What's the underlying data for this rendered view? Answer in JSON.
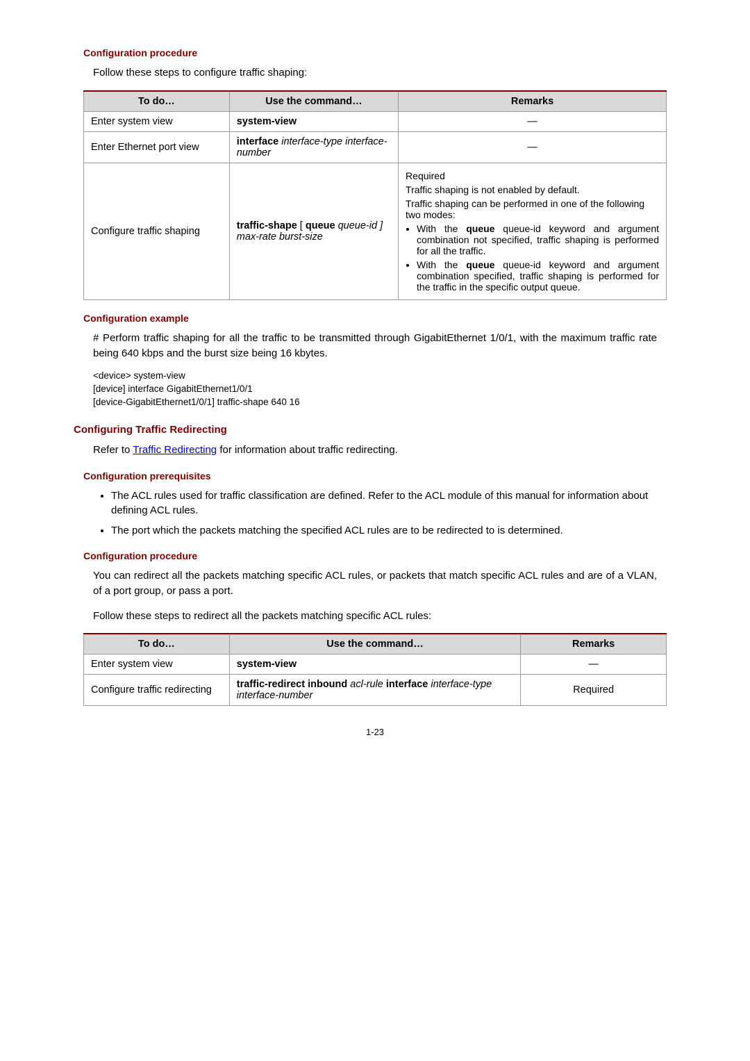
{
  "sec1": {
    "h_proc": "Configuration procedure",
    "intro": "Follow these steps to configure traffic shaping:",
    "table": {
      "head": {
        "c1": "To do…",
        "c2": "Use the command…",
        "c3": "Remarks"
      },
      "r1": {
        "c1": "Enter system view",
        "c2": "system-view",
        "c3": "—"
      },
      "r2": {
        "c1": "Enter Ethernet port view",
        "c2a": "interface",
        "c2b": " interface-type interface-number",
        "c3": "—"
      },
      "r3": {
        "c1": "Configure traffic shaping",
        "c2a": "traffic-shape",
        "c2b": " [ ",
        "c2c": "queue",
        "c2d": " queue-id ] max-rate burst-size",
        "rem_req": "Required",
        "rem_p1": "Traffic shaping is not enabled by default.",
        "rem_p2": "Traffic shaping can be performed in one of the following two modes:",
        "rem_li1a": "With the ",
        "rem_li1b": "queue",
        "rem_li1c": " queue-id keyword and argument combination not specified, traffic shaping is performed for all the traffic.",
        "rem_li2a": "With the ",
        "rem_li2b": "queue",
        "rem_li2c": " queue-id keyword and argument combination specified, traffic shaping is performed for the traffic in the specific output queue."
      }
    }
  },
  "sec2": {
    "h_ex": "Configuration example",
    "p1": "# Perform traffic shaping for all the traffic to be transmitted through GigabitEthernet 1/0/1, with the maximum traffic rate being 640 kbps and the burst size being 16 kbytes.",
    "code1": "<device> system-view",
    "code2": "[device] interface GigabitEthernet1/0/1",
    "code3": "[device-GigabitEthernet1/0/1] traffic-shape 640 16"
  },
  "sec3": {
    "h_main": "Configuring Traffic Redirecting",
    "ref_a": "Refer to ",
    "ref_link": "Traffic Redirecting",
    "ref_b": " for information about traffic redirecting.",
    "h_prereq": "Configuration prerequisites",
    "li1": "The ACL rules used for traffic classification are defined. Refer to the ACL module of this manual for information about defining ACL rules.",
    "li2": "The port which the packets matching the specified ACL rules are to be redirected to is determined.",
    "h_proc": "Configuration procedure",
    "p1": "You can redirect all the packets matching specific ACL rules, or packets that match specific ACL rules and are of a VLAN, of a port group, or pass a port.",
    "p2": "Follow these steps to redirect all the packets matching specific ACL rules:",
    "table": {
      "head": {
        "c1": "To do…",
        "c2": "Use the command…",
        "c3": "Remarks"
      },
      "r1": {
        "c1": "Enter system view",
        "c2": "system-view",
        "c3": "—"
      },
      "r2": {
        "c1": "Configure traffic redirecting",
        "c2a": "traffic-redirect inbound",
        "c2b": " acl-rule ",
        "c2c": "interface",
        "c2d": " interface-type interface-number",
        "c3": "Required"
      }
    }
  },
  "pagenum": "1-23"
}
